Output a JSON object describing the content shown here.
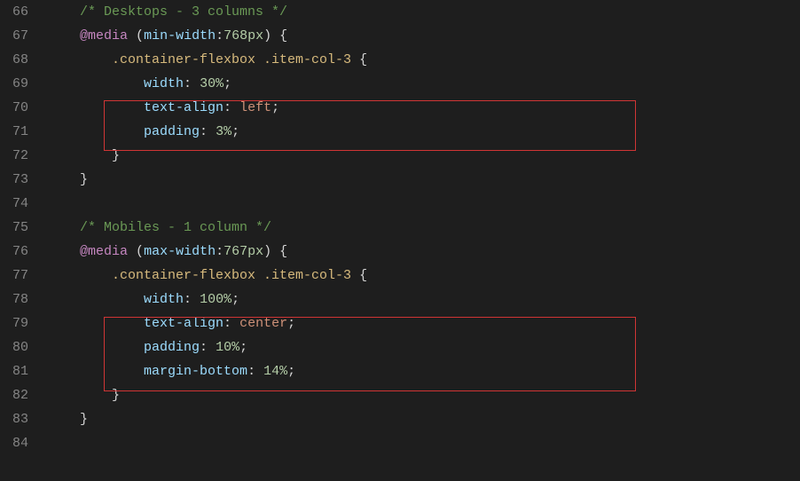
{
  "gutter": {
    "start": 66,
    "end": 84
  },
  "code": {
    "l66": {
      "indent1": "    ",
      "comment": "/* Desktops - 3 columns */"
    },
    "l67": {
      "indent1": "    ",
      "at": "@media",
      "sp": " ",
      "lp": "(",
      "prop": "min-width",
      "colon": ":",
      "val": "768px",
      "rp": ")",
      "sp2": " ",
      "ob": "{"
    },
    "l68": {
      "indent2": "        ",
      "sel": ".container-flexbox .item-col-3",
      "sp": " ",
      "ob": "{"
    },
    "l69": {
      "indent3": "            ",
      "prop": "width",
      "colon": ": ",
      "val": "30%",
      "sc": ";"
    },
    "l70": {
      "indent3": "            ",
      "prop": "text-align",
      "colon": ": ",
      "val": "left",
      "sc": ";"
    },
    "l71": {
      "indent3": "            ",
      "prop": "padding",
      "colon": ": ",
      "val": "3%",
      "sc": ";"
    },
    "l72": {
      "indent2": "        ",
      "cb": "}"
    },
    "l73": {
      "indent1": "    ",
      "cb": "}"
    },
    "l74": {
      "blank": " "
    },
    "l75": {
      "indent1": "    ",
      "comment": "/* Mobiles - 1 column */"
    },
    "l76": {
      "indent1": "    ",
      "at": "@media",
      "sp": " ",
      "lp": "(",
      "prop": "max-width",
      "colon": ":",
      "val": "767px",
      "rp": ")",
      "sp2": " ",
      "ob": "{"
    },
    "l77": {
      "indent2": "        ",
      "sel": ".container-flexbox .item-col-3",
      "sp": " ",
      "ob": "{"
    },
    "l78": {
      "indent3": "            ",
      "prop": "width",
      "colon": ": ",
      "val": "100%",
      "sc": ";"
    },
    "l79": {
      "indent3": "            ",
      "prop": "text-align",
      "colon": ": ",
      "val": "center",
      "sc": ";"
    },
    "l80": {
      "indent3": "            ",
      "prop": "padding",
      "colon": ": ",
      "val": "10%",
      "sc": ";"
    },
    "l81": {
      "indent3": "            ",
      "prop": "margin-bottom",
      "colon": ": ",
      "val": "14%",
      "sc": ";"
    },
    "l82": {
      "indent2": "        ",
      "cb": "}"
    },
    "l83": {
      "indent1": "    ",
      "cb": "}"
    },
    "l84": {
      "blank": " "
    }
  }
}
